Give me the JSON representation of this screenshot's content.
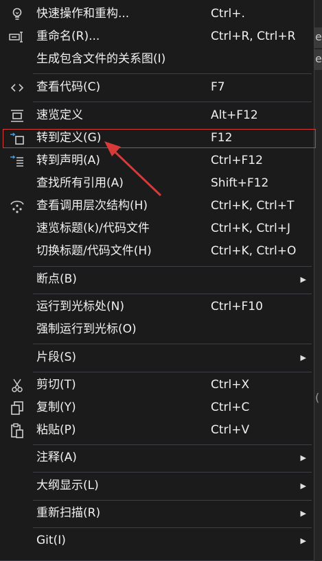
{
  "menu": {
    "items": [
      {
        "label": "快速操作和重构...",
        "shortcut": "Ctrl+.",
        "icon": "lightbulb-icon"
      },
      {
        "label": "重命名(R)...",
        "shortcut": "Ctrl+R, Ctrl+R",
        "icon": "rename-icon"
      },
      {
        "label": "生成包含文件的关系图(I)",
        "shortcut": "",
        "icon": ""
      },
      {
        "label": "查看代码(C)",
        "shortcut": "F7",
        "icon": "code-icon"
      },
      {
        "label": "速览定义",
        "shortcut": "Alt+F12",
        "icon": "peek-definition-icon"
      },
      {
        "label": "转到定义(G)",
        "shortcut": "F12",
        "icon": "go-to-definition-icon"
      },
      {
        "label": "转到声明(A)",
        "shortcut": "Ctrl+F12",
        "icon": "go-to-declaration-icon"
      },
      {
        "label": "查找所有引用(A)",
        "shortcut": "Shift+F12",
        "icon": ""
      },
      {
        "label": "查看调用层次结构(H)",
        "shortcut": "Ctrl+K, Ctrl+T",
        "icon": "call-hierarchy-icon"
      },
      {
        "label": "速览标题(k)/代码文件",
        "shortcut": "Ctrl+K, Ctrl+J",
        "icon": ""
      },
      {
        "label": "切换标题/代码文件(H)",
        "shortcut": "Ctrl+K, Ctrl+O",
        "icon": ""
      },
      {
        "label": "断点(B)",
        "shortcut": "",
        "icon": ""
      },
      {
        "label": "运行到光标处(N)",
        "shortcut": "Ctrl+F10",
        "icon": ""
      },
      {
        "label": "强制运行到光标(O)",
        "shortcut": "",
        "icon": ""
      },
      {
        "label": "片段(S)",
        "shortcut": "",
        "icon": ""
      },
      {
        "label": "剪切(T)",
        "shortcut": "Ctrl+X",
        "icon": "cut-icon"
      },
      {
        "label": "复制(Y)",
        "shortcut": "Ctrl+C",
        "icon": "copy-icon"
      },
      {
        "label": "粘贴(P)",
        "shortcut": "Ctrl+V",
        "icon": "paste-icon"
      },
      {
        "label": "注释(A)",
        "shortcut": "",
        "icon": ""
      },
      {
        "label": "大纲显示(L)",
        "shortcut": "",
        "icon": ""
      },
      {
        "label": "重新扫描(R)",
        "shortcut": "",
        "icon": ""
      },
      {
        "label": "Git(I)",
        "shortcut": "",
        "icon": ""
      }
    ]
  },
  "background": {
    "edge_chars": [
      "e",
      "e",
      "("
    ]
  },
  "colors": {
    "menu_bg": "#1b1b1c",
    "text": "#f1f1f1",
    "separator": "#3f3f46",
    "annotation": "#d83a3a",
    "icon_blue": "#3c9de8"
  }
}
